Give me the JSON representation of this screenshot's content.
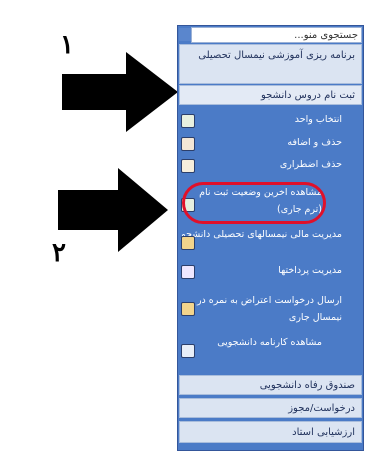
{
  "annotations": {
    "label_1": "١",
    "label_2": "٢"
  },
  "menu": {
    "search_placeholder": "جستجوی منو...",
    "section_top": "برنامه ریزی آموزشی نیمسال تحصیلی",
    "section_registration": "ثبت نام دروس دانشجو",
    "items": [
      {
        "label": "انتخاب واحد",
        "icon": "document-edit-icon"
      },
      {
        "label": "حذف و اضافه",
        "icon": "add-remove-icon"
      },
      {
        "label": "حذف اضطراری",
        "icon": "checklist-icon"
      },
      {
        "label": "مشاهده اخرین وضعیت ثبت نام (ترم جاری)",
        "icon": "report-icon"
      },
      {
        "label": "مدیریت مالی نیمسالهای تحصیلی دانشجو",
        "icon": "finance-icon"
      },
      {
        "label": "مدیریت پرداختها",
        "icon": "payment-icon"
      },
      {
        "label": "ارسال درخواست اعتراض به نمره در نیمسال جاری",
        "icon": "request-icon"
      },
      {
        "label": "مشاهده کارنامه دانشجویی",
        "icon": "transcript-icon"
      }
    ],
    "section_welfare": "صندوق رفاه دانشجویی",
    "section_requests": "درخواست/مجوز",
    "section_evaluation": "ارزشیابی استاد"
  },
  "colors": {
    "panel": "#4b7bc7",
    "highlight": "#e0102a",
    "arrow": "#000000"
  }
}
